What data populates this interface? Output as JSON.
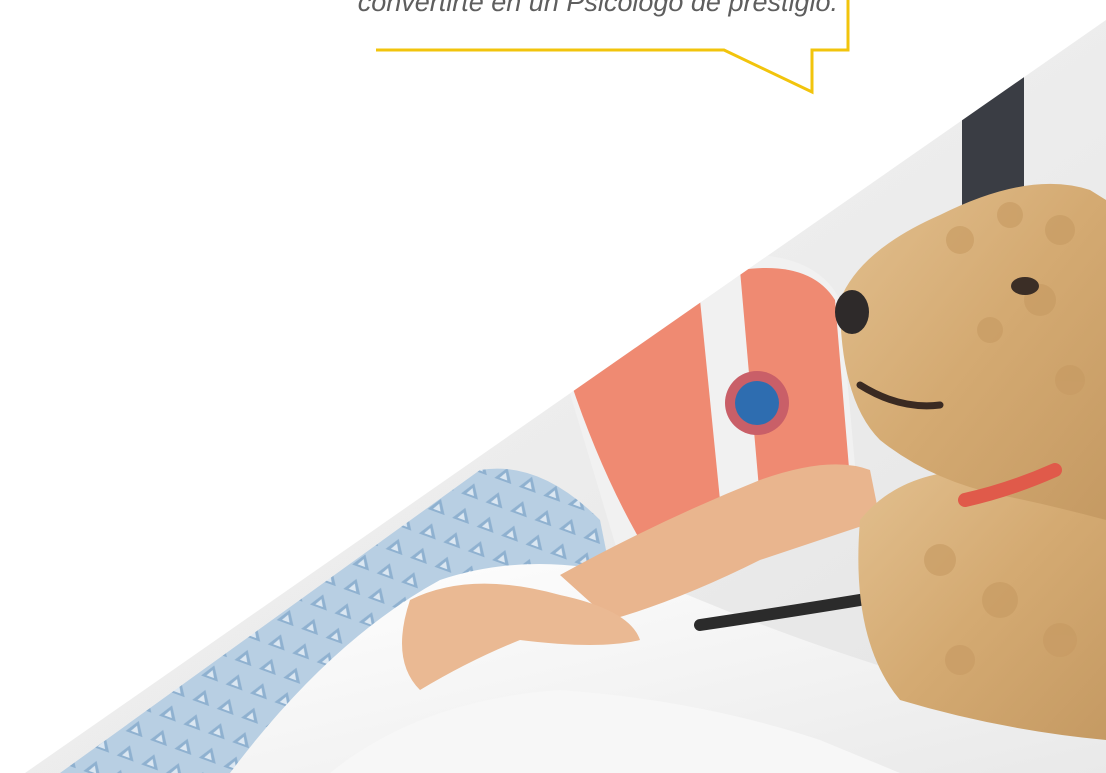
{
  "quote": {
    "visible_text": "convertirte en un Psicólogo de prestigio."
  },
  "colors": {
    "accent_yellow": "#f2c40c",
    "text_gray": "#5e5e5e",
    "background": "#ffffff"
  },
  "photo": {
    "subject": "therapy-dog-with-hospital-patient",
    "icon_name": "photo-illustration"
  }
}
